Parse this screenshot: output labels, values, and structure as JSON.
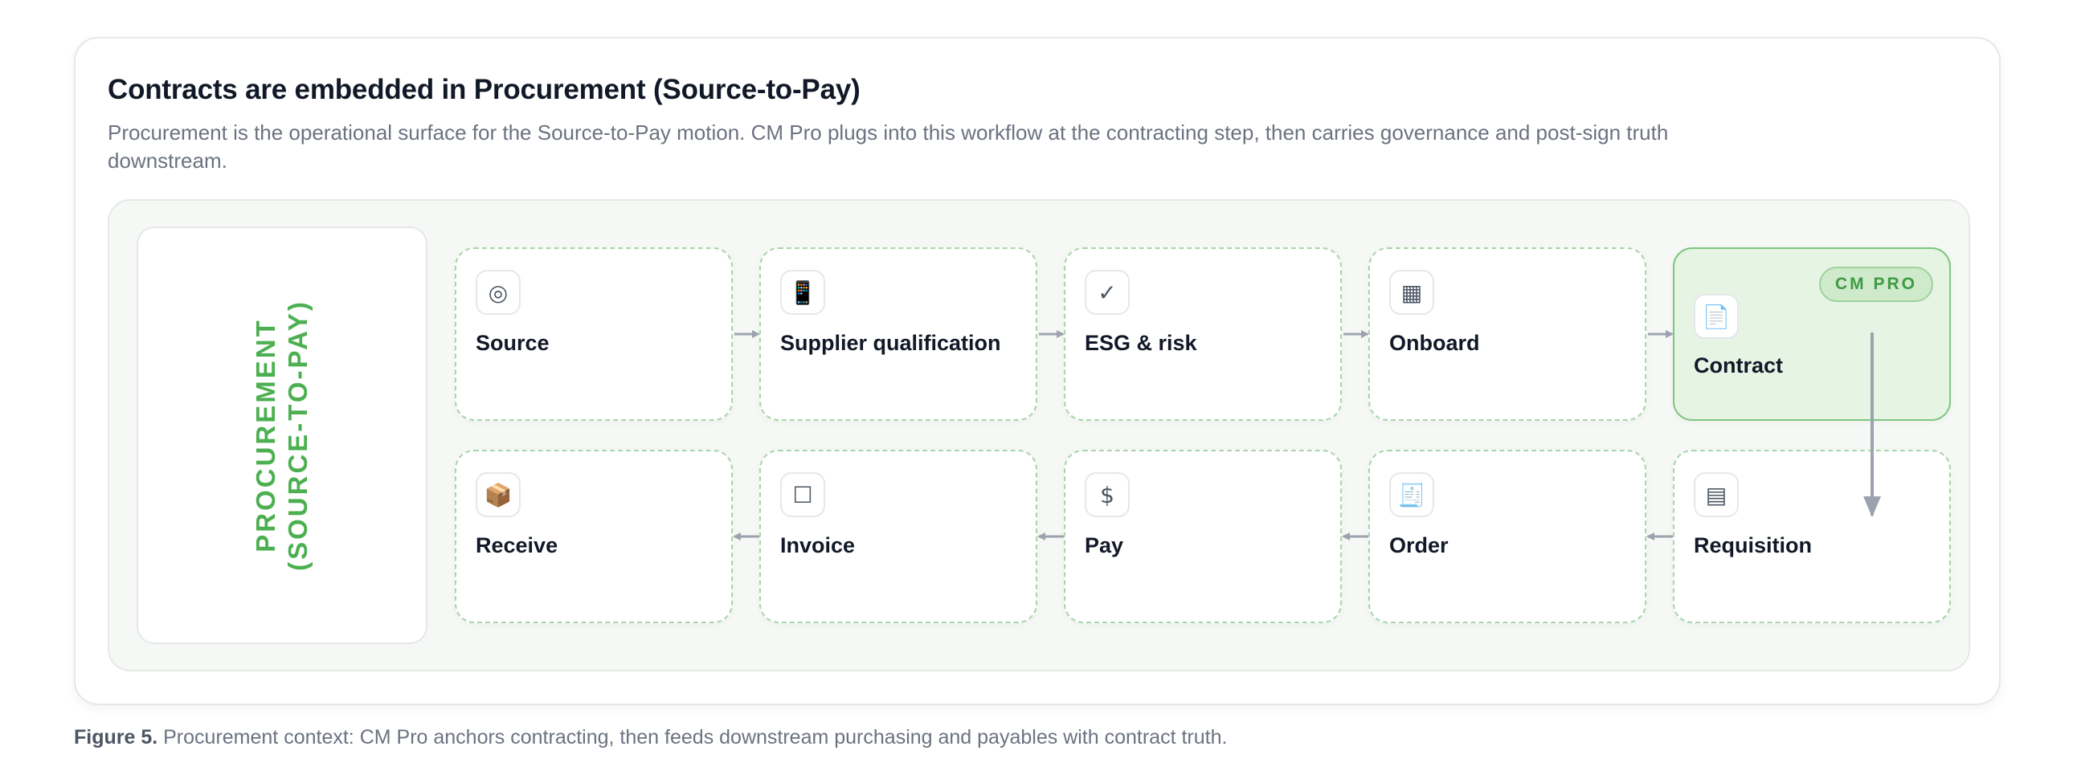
{
  "card": {
    "title": "Contracts are embedded in Procurement (Source-to-Pay)",
    "description": "Procurement is the operational surface for the Source-to-Pay motion. CM Pro plugs into this workflow at the contracting step, then carries governance and post-sign truth downstream."
  },
  "panel": {
    "side_label_line1": "PROCUREMENT",
    "side_label_line2": "(SOURCE-TO-PAY)"
  },
  "steps": {
    "source": {
      "label": "Source",
      "icon": "target-icon",
      "glyph": "◎"
    },
    "supplier": {
      "label": "Supplier qualification",
      "icon": "phone-icon",
      "glyph": "📱"
    },
    "esg": {
      "label": "ESG & risk",
      "icon": "checkmark-icon",
      "glyph": "✓"
    },
    "onboard": {
      "label": "Onboard",
      "icon": "grid-icon",
      "glyph": "▦"
    },
    "contract": {
      "label": "Contract",
      "icon": "document-icon",
      "glyph": "📄",
      "badge": "CM PRO"
    },
    "requisition": {
      "label": "Requisition",
      "icon": "list-icon",
      "glyph": "▤"
    },
    "order": {
      "label": "Order",
      "icon": "receipt-icon",
      "glyph": "🧾"
    },
    "pay": {
      "label": "Pay",
      "icon": "dollar-icon",
      "glyph": "$"
    },
    "invoice": {
      "label": "Invoice",
      "icon": "square-icon",
      "glyph": "☐"
    },
    "receive": {
      "label": "Receive",
      "icon": "package-icon",
      "glyph": "📦"
    }
  },
  "caption": {
    "prefix": "Figure 5.",
    "text": " Procurement context: CM Pro anchors contracting, then feeds downstream purchasing and payables with contract truth."
  },
  "colors": {
    "accent_green": "#4caf50",
    "highlight_fill": "#e6f4e4",
    "dashed_border": "#a8d5a8",
    "connector": "#9ca3af"
  }
}
